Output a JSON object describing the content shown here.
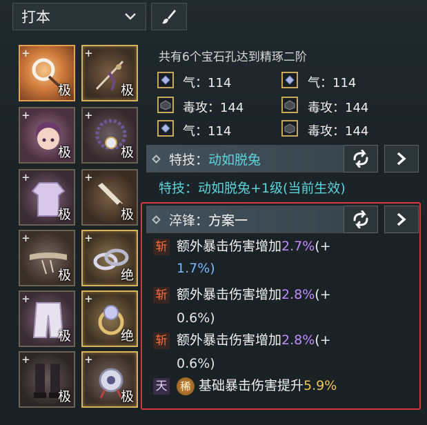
{
  "preset": {
    "selected": "打本"
  },
  "equipment": {
    "slots": [
      {
        "plus": "+",
        "grade": "极"
      },
      {
        "plus": "+",
        "grade": "极"
      },
      {
        "plus": "+",
        "grade": "极"
      },
      {
        "plus": "+",
        "grade": "极"
      },
      {
        "plus": "+",
        "grade": "极"
      },
      {
        "plus": "+",
        "grade": "极"
      },
      {
        "plus": "+",
        "grade": "极"
      },
      {
        "plus": "+",
        "grade": "绝"
      },
      {
        "plus": "+",
        "grade": "极"
      },
      {
        "plus": "+",
        "grade": "绝"
      },
      {
        "plus": "+",
        "grade": "极"
      },
      {
        "plus": "+",
        "grade": "极"
      }
    ]
  },
  "gems": {
    "summary": "共有6个宝石孔达到精琢二阶",
    "items": [
      {
        "text": "气：114",
        "icon": "blue-gem-icon"
      },
      {
        "text": "气：114",
        "icon": "blue-gem-icon"
      },
      {
        "text": "毒攻：144",
        "icon": "dark-gem-icon"
      },
      {
        "text": "毒攻：144",
        "icon": "dark-gem-icon"
      },
      {
        "text": "气：114",
        "icon": "blue-gem-icon"
      },
      {
        "text": "毒攻：144",
        "icon": "dark-gem-icon"
      }
    ]
  },
  "skill": {
    "label": "特技：",
    "name": "动如脱兔",
    "active_label": "特技：",
    "active_value": "动如脱兔+1级(当前生效)"
  },
  "temper": {
    "label": "淬锋：",
    "name": "方案一",
    "lines": [
      {
        "tag": "斩",
        "text": "额外暴击伤害增加",
        "value": "2.7%",
        "rest1": "(+",
        "rest2": "1.7%)"
      },
      {
        "tag": "斩",
        "text": "额外暴击伤害增加",
        "value": "2.8%",
        "rest1": "(+",
        "rest2": "0.6%)"
      },
      {
        "tag": "斩",
        "text": "额外暴击伤害增加",
        "value": "2.8%",
        "rest1": "(+",
        "rest2": "0.6%)"
      }
    ],
    "extra": {
      "tag": "天",
      "badge": "稀",
      "text": "基础暴击伤害提升",
      "value": "5.9%"
    }
  },
  "colors": {
    "accent_cyan": "#5cd4dc",
    "accent_purple": "#c08cff",
    "accent_gold": "#f0c45a",
    "highlight_red": "#d8373f"
  }
}
